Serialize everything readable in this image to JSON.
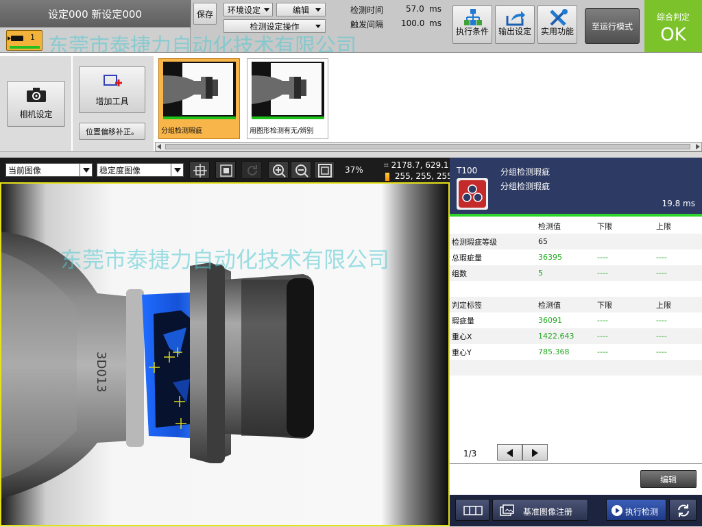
{
  "header": {
    "setting_title": "设定000 新设定000",
    "camera_chip_number": "1",
    "save_label": "保存",
    "env_setting_label": "环境设定",
    "edit_label": "编辑",
    "inspection_setting_op_label": "检测设定操作",
    "detect_time_label": "检测时间",
    "detect_time_value": "57.0",
    "detect_time_unit": "ms",
    "trigger_interval_label": "触发间隔",
    "trigger_interval_value": "100.0",
    "trigger_interval_unit": "ms",
    "exec_condition_label": "执行条件",
    "output_setting_label": "输出设定",
    "utility_label": "实用功能",
    "run_mode_label": "至运行模式",
    "judge_title": "综合判定",
    "judge_value": "OK",
    "watermark_text": "东莞市泰捷力自动化技术有限公司"
  },
  "toolstrip": {
    "camera_setting_label": "相机设定",
    "add_tool_label": "增加工具",
    "position_correction_label": "位置偏移补正。",
    "tiles": [
      {
        "label": "分组检测瑕疵",
        "selected": true
      },
      {
        "label": "用图形检测有无/辨别",
        "selected": false
      }
    ]
  },
  "image_toolbar": {
    "view_select": "当前图像",
    "filter_select": "稳定度图像",
    "zoom_percent": "37%",
    "cursor_coord": "2178.7, 629.1",
    "pixel_value": "255, 255, 255"
  },
  "viewer": {
    "watermark_text": "东莞市泰捷力自动化技术有限公司",
    "bottle_text": "3D013"
  },
  "result_panel": {
    "tool_id": "T100",
    "tool_name": "分组检测瑕疵",
    "tool_subname": "分组检测瑕疵",
    "elapsed": "19.8 ms",
    "table1": {
      "headers": [
        "",
        "检测值",
        "下限",
        "上限"
      ],
      "rows": [
        {
          "label": "检测瑕疵等级",
          "value": "65",
          "low": "",
          "high": ""
        },
        {
          "label": "总瑕疵量",
          "value": "36395",
          "low": "----",
          "high": "----"
        },
        {
          "label": "组数",
          "value": "5",
          "low": "----",
          "high": "----"
        }
      ]
    },
    "table2": {
      "headers": [
        "判定标签",
        "检测值",
        "下限",
        "上限"
      ],
      "rows": [
        {
          "label": "瑕疵量",
          "value": "36091",
          "low": "----",
          "high": "----"
        },
        {
          "label": "重心X",
          "value": "1422.643",
          "low": "----",
          "high": "----"
        },
        {
          "label": "重心Y",
          "value": "785.368",
          "low": "----",
          "high": "----"
        }
      ]
    },
    "page_indicator": "1/3",
    "edit_label": "编辑",
    "register_ref_label": "基准图像注册",
    "exec_detect_label": "执行检测"
  },
  "colors": {
    "judge_ok": "#7cc22a",
    "camera_chip": "#f3b33a",
    "panel_header": "#2d3a63",
    "status_green": "#2dd42a",
    "value_green": "#1fa81f",
    "viewer_border": "#e6e018",
    "defect_blue": "#1f6bff"
  }
}
